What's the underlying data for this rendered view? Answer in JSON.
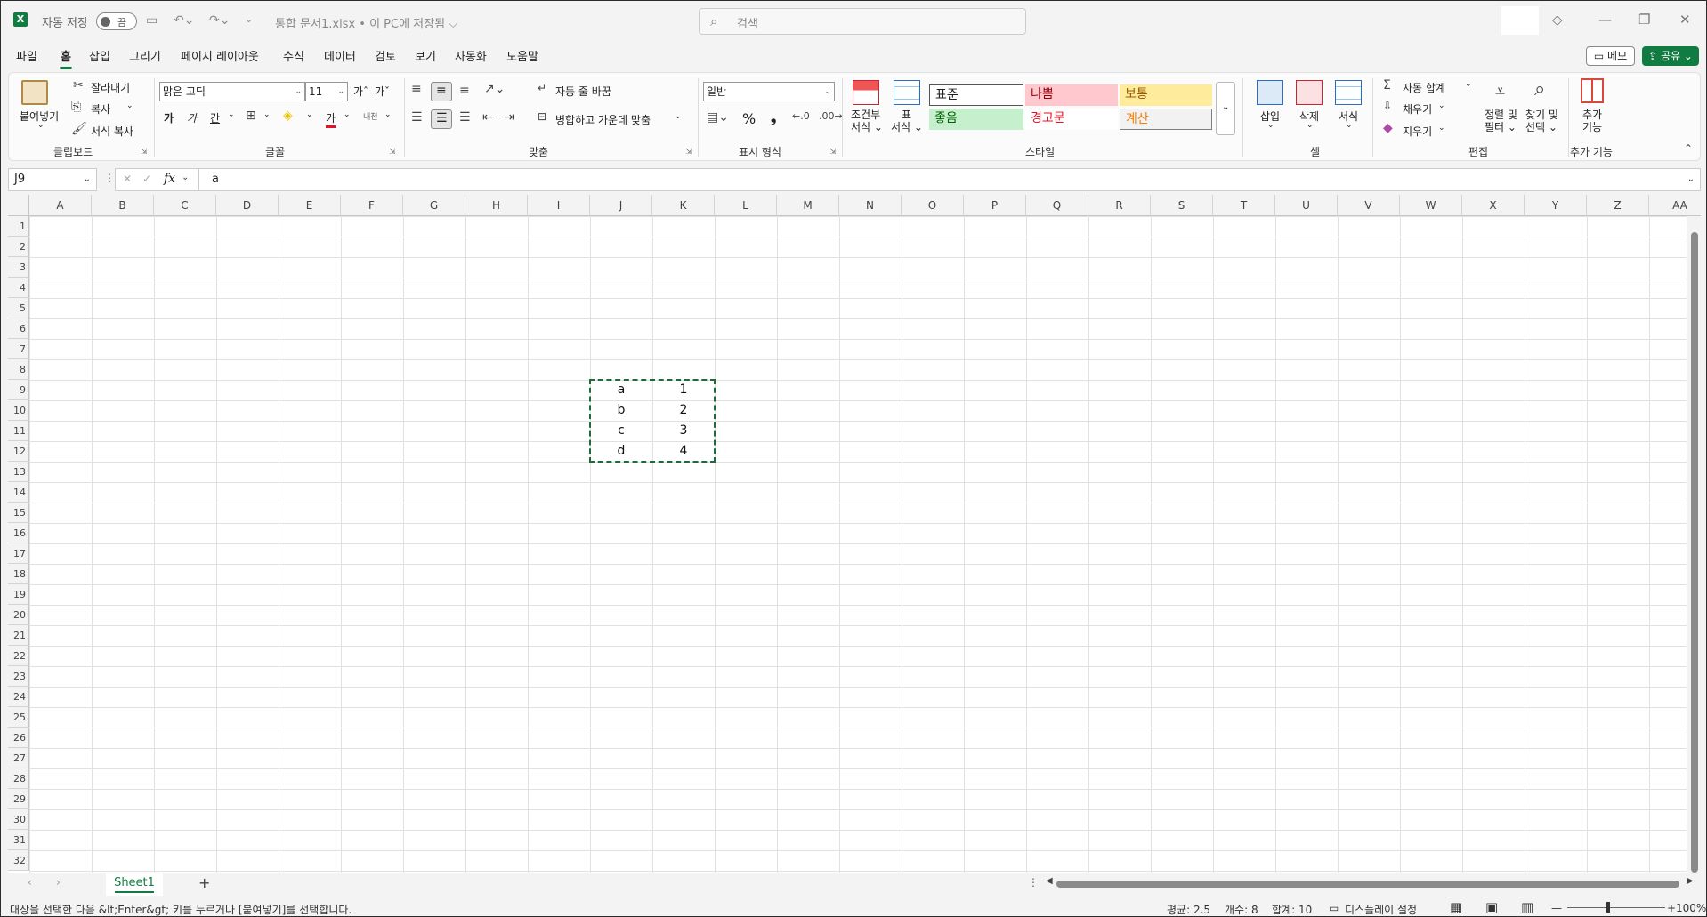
{
  "titlebar": {
    "app_icon": "X",
    "autosave_label": "자동 저장",
    "autosave_state": "끔",
    "document_title": "통합 문서1.xlsx • 이 PC에 저장됨 ⌵",
    "search_placeholder": "검색"
  },
  "tabs": [
    {
      "label": "파일"
    },
    {
      "label": "홈"
    },
    {
      "label": "삽입"
    },
    {
      "label": "그리기"
    },
    {
      "label": "페이지 레이아웃"
    },
    {
      "label": "수식"
    },
    {
      "label": "데이터"
    },
    {
      "label": "검토"
    },
    {
      "label": "보기"
    },
    {
      "label": "자동화"
    },
    {
      "label": "도움말"
    }
  ],
  "active_tab": "홈",
  "header_buttons": {
    "memo": "메모",
    "share": "공유"
  },
  "ribbon": {
    "clipboard": {
      "group_label": "클립보드",
      "paste": "붙여넣기",
      "cut": "잘라내기",
      "copy": "복사",
      "format_painter": "서식 복사"
    },
    "font": {
      "group_label": "글꼴",
      "font_name": "맑은 고딕",
      "font_size": "11",
      "bold": "가",
      "italic": "가",
      "underline": "간",
      "grow": "가ˆ",
      "shrink": "가ˇ",
      "font_color_glyph": "가",
      "phonetic": "내천"
    },
    "alignment": {
      "group_label": "맞춤",
      "wrap_text": "자동 줄 바꿈",
      "merge_center": "병합하고 가운데 맞춤"
    },
    "number": {
      "group_label": "표시 형식",
      "format": "일반",
      "percent": "%",
      "comma": "❟"
    },
    "styles": {
      "group_label": "스타일",
      "conditional": "조건부\n서식",
      "conditional_1": "조건부",
      "conditional_2": "서식 ⌄",
      "as_table_1": "표",
      "as_table_2": "서식 ⌄",
      "normal": "표준",
      "bad": "나쁨",
      "neutral": "보통",
      "good": "좋음",
      "warning": "경고문",
      "calculation": "계산"
    },
    "cells": {
      "group_label": "셀",
      "insert": "삽입",
      "delete": "삭제",
      "format": "서식"
    },
    "editing": {
      "group_label": "편집",
      "autosum": "자동 합계",
      "fill": "채우기",
      "clear": "지우기",
      "sort_filter_1": "정렬 및",
      "sort_filter_2": "필터 ⌄",
      "find_select_1": "찾기 및",
      "find_select_2": "선택 ⌄"
    },
    "addins": {
      "group_label": "추가 기능",
      "addins_1": "추가",
      "addins_2": "기능"
    }
  },
  "formula_bar": {
    "name_box": "J9",
    "fx": "fx",
    "content": "a"
  },
  "columns": [
    "A",
    "B",
    "C",
    "D",
    "E",
    "F",
    "G",
    "H",
    "I",
    "J",
    "K",
    "L",
    "M",
    "N",
    "O",
    "P",
    "Q",
    "R",
    "S",
    "T",
    "U",
    "V",
    "W",
    "X",
    "Y",
    "Z",
    "AA"
  ],
  "rows": [
    "1",
    "2",
    "3",
    "4",
    "5",
    "6",
    "7",
    "8",
    "9",
    "10",
    "11",
    "12",
    "13",
    "14",
    "15",
    "16",
    "17",
    "18",
    "19",
    "20",
    "21",
    "22",
    "23",
    "24",
    "25",
    "26",
    "27",
    "28",
    "29",
    "30",
    "31",
    "32"
  ],
  "cells": [
    {
      "ref": "J9",
      "value": "a"
    },
    {
      "ref": "K9",
      "value": "1"
    },
    {
      "ref": "J10",
      "value": "b"
    },
    {
      "ref": "K10",
      "value": "2"
    },
    {
      "ref": "J11",
      "value": "c"
    },
    {
      "ref": "K11",
      "value": "3"
    },
    {
      "ref": "J12",
      "value": "d"
    },
    {
      "ref": "K12",
      "value": "4"
    }
  ],
  "copy_range": "J9:K12",
  "sheets": [
    {
      "name": "Sheet1",
      "active": true
    }
  ],
  "status": {
    "message": "대상을 선택한 다음 &lt;Enter&gt; 키를 누르거나 [붙여넣기]를 선택합니다.",
    "average": "평균: 2.5",
    "count": "개수: 8",
    "sum": "합계: 10",
    "display_settings": "디스플레이 설정",
    "zoom": "100%"
  },
  "colors": {
    "accent": "#107c41",
    "style_bad_bg": "#ffc7ce",
    "style_bad_fg": "#9c0006",
    "style_neutral_bg": "#ffeb9c",
    "style_neutral_fg": "#9c5700",
    "style_good_bg": "#c6efce",
    "style_good_fg": "#006100",
    "style_calc_bg": "#f2f2f2",
    "style_calc_fg": "#fa7d00"
  }
}
